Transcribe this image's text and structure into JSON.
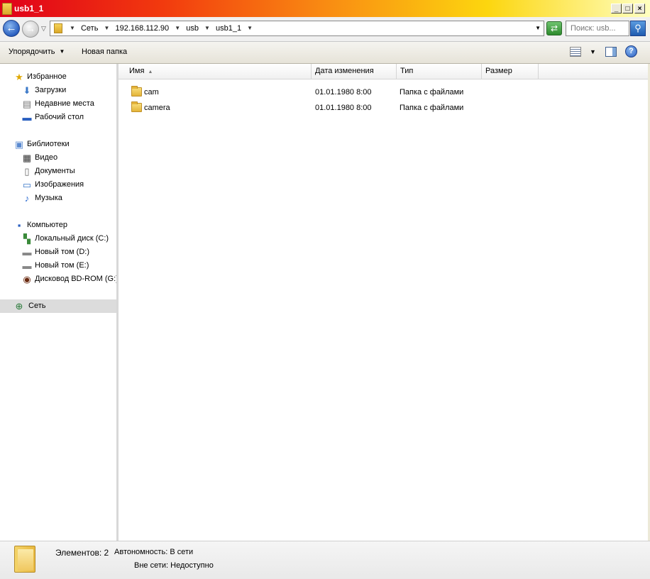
{
  "window": {
    "title": "usb1_1"
  },
  "title_buttons": {
    "minimize": "_",
    "maximize": "□",
    "close": "×"
  },
  "address": {
    "segments": [
      "Сеть",
      "192.168.112.90",
      "usb",
      "usb1_1"
    ]
  },
  "search": {
    "placeholder": "Поиск: usb..."
  },
  "toolbar": {
    "organize_label": "Упорядочить",
    "new_folder_label": "Новая папка"
  },
  "navigation": {
    "favorites": {
      "label": "Избранное",
      "items": [
        "Загрузки",
        "Недавние места",
        "Рабочий стол"
      ]
    },
    "libraries": {
      "label": "Библиотеки",
      "items": [
        "Видео",
        "Документы",
        "Изображения",
        "Музыка"
      ]
    },
    "computer": {
      "label": "Компьютер",
      "items": [
        "Локальный диск (C:)",
        "Новый том (D:)",
        "Новый том (E:)",
        "Дисковод BD-ROM (G:)"
      ]
    },
    "network": {
      "label": "Сеть",
      "selected": true
    }
  },
  "columns": {
    "name": "Имя",
    "date": "Дата изменения",
    "type": "Тип",
    "size": "Размер"
  },
  "files": [
    {
      "name": "cam",
      "date": "01.01.1980 8:00",
      "type": "Папка с файлами",
      "size": ""
    },
    {
      "name": "camera",
      "date": "01.01.1980 8:00",
      "type": "Папка с файлами",
      "size": ""
    }
  ],
  "details": {
    "count_label": "Элементов: 2",
    "offline_label": "Автономность:",
    "offline_value": "В сети",
    "availability_label": "Вне сети:",
    "availability_value": "Недоступно"
  }
}
